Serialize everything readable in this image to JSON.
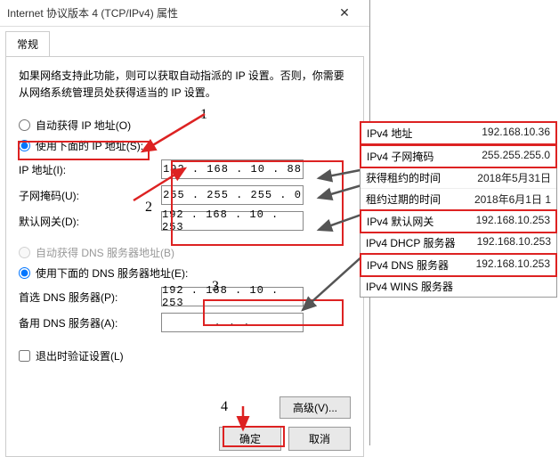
{
  "title": "Internet 协议版本 4 (TCP/IPv4) 属性",
  "tab": "常规",
  "intro": "如果网络支持此功能，则可以获取自动指派的 IP 设置。否则，你需要从网络系统管理员处获得适当的 IP 设置。",
  "radio_auto_ip": "自动获得 IP 地址(O)",
  "radio_manual_ip": "使用下面的 IP 地址(S):",
  "label_ip": "IP 地址(I):",
  "label_mask": "子网掩码(U):",
  "label_gateway": "默认网关(D):",
  "val_ip": "192 . 168 .  10  .  88",
  "val_mask": "255 . 255 . 255 .   0",
  "val_gateway": "192 . 168 .  10  . 253",
  "radio_auto_dns": "自动获得 DNS 服务器地址(B)",
  "radio_manual_dns": "使用下面的 DNS 服务器地址(E):",
  "label_dns1": "首选 DNS 服务器(P):",
  "label_dns2": "备用 DNS 服务器(A):",
  "val_dns1": "192 . 168 .  10  . 253",
  "val_dns2": ".       .       .",
  "checkbox_exit": "退出时验证设置(L)",
  "btn_adv": "高级(V)...",
  "btn_ok": "确定",
  "btn_cancel": "取消",
  "annot_1": "1",
  "annot_2": "2",
  "annot_3": "3",
  "annot_4": "4",
  "panel": [
    {
      "k": "IPv4 地址",
      "v": "192.168.10.36",
      "hl": true
    },
    {
      "k": "IPv4 子网掩码",
      "v": "255.255.255.0",
      "hl": true
    },
    {
      "k": "获得租约的时间",
      "v": "2018年5月31日"
    },
    {
      "k": "租约过期的时间",
      "v": "2018年6月1日 1"
    },
    {
      "k": "IPv4 默认网关",
      "v": "192.168.10.253",
      "hl": true
    },
    {
      "k": "IPv4 DHCP 服务器",
      "v": "192.168.10.253"
    },
    {
      "k": "IPv4 DNS 服务器",
      "v": "192.168.10.253",
      "hl": true
    },
    {
      "k": "IPv4 WINS 服务器",
      "v": ""
    }
  ]
}
